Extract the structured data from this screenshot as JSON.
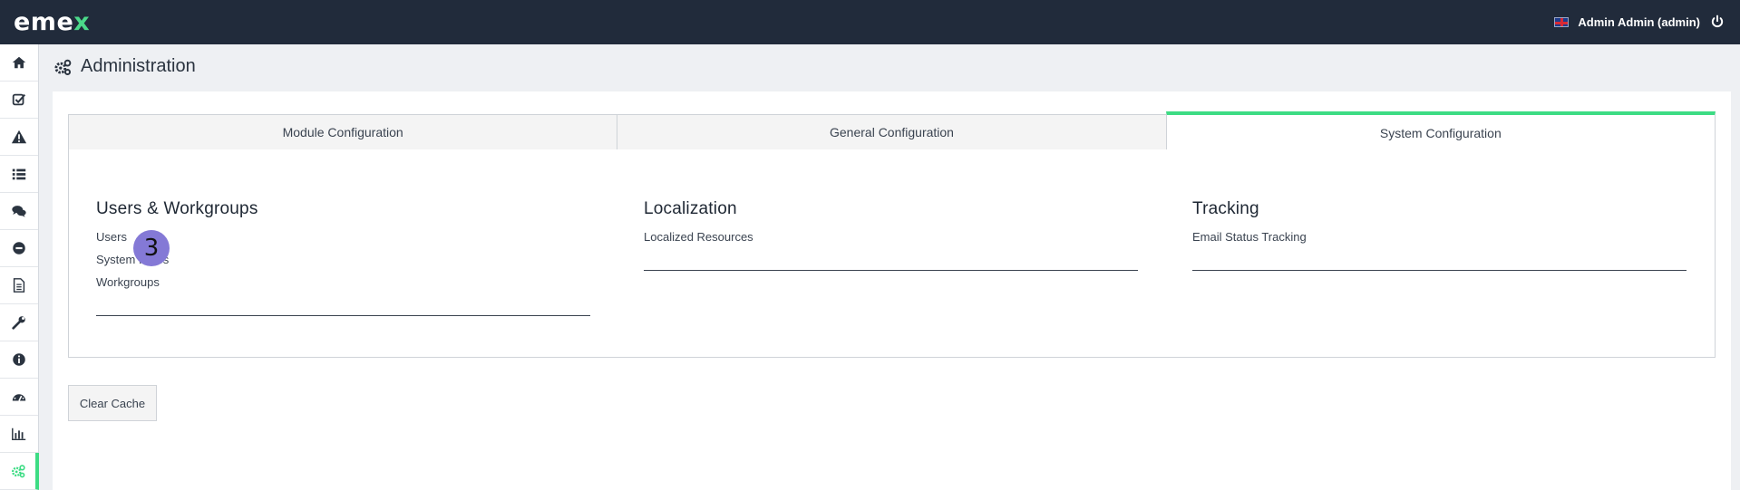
{
  "app": {
    "logo_main": "eme",
    "logo_x": "x"
  },
  "user": {
    "display_name": "Admin Admin (admin)",
    "flag_icon": "uk-flag-icon"
  },
  "sidebar": {
    "items": [
      {
        "icon": "home-icon"
      },
      {
        "icon": "checkbox-icon"
      },
      {
        "icon": "warning-icon"
      },
      {
        "icon": "list-icon"
      },
      {
        "icon": "chat-icon"
      },
      {
        "icon": "minus-circle-icon"
      },
      {
        "icon": "document-icon"
      },
      {
        "icon": "wrench-icon"
      },
      {
        "icon": "info-icon"
      },
      {
        "icon": "dashboard-icon"
      },
      {
        "icon": "bar-chart-icon"
      },
      {
        "icon": "gears-icon",
        "active": true
      }
    ]
  },
  "page": {
    "title": "Administration"
  },
  "tabs": [
    {
      "label": "Module Configuration"
    },
    {
      "label": "General Configuration"
    },
    {
      "label": "System Configuration",
      "active": true
    }
  ],
  "sections": {
    "users": {
      "title": "Users & Workgroups",
      "links": [
        "Users",
        "System Roles",
        "Workgroups"
      ]
    },
    "localization": {
      "title": "Localization",
      "links": [
        "Localized Resources"
      ]
    },
    "tracking": {
      "title": "Tracking",
      "links": [
        "Email Status Tracking"
      ]
    }
  },
  "badge": {
    "value": "3"
  },
  "actions": {
    "clear_cache": "Clear Cache"
  },
  "colors": {
    "topbar": "#212b3b",
    "accent": "#3ddc84",
    "badge": "#8479d6"
  }
}
